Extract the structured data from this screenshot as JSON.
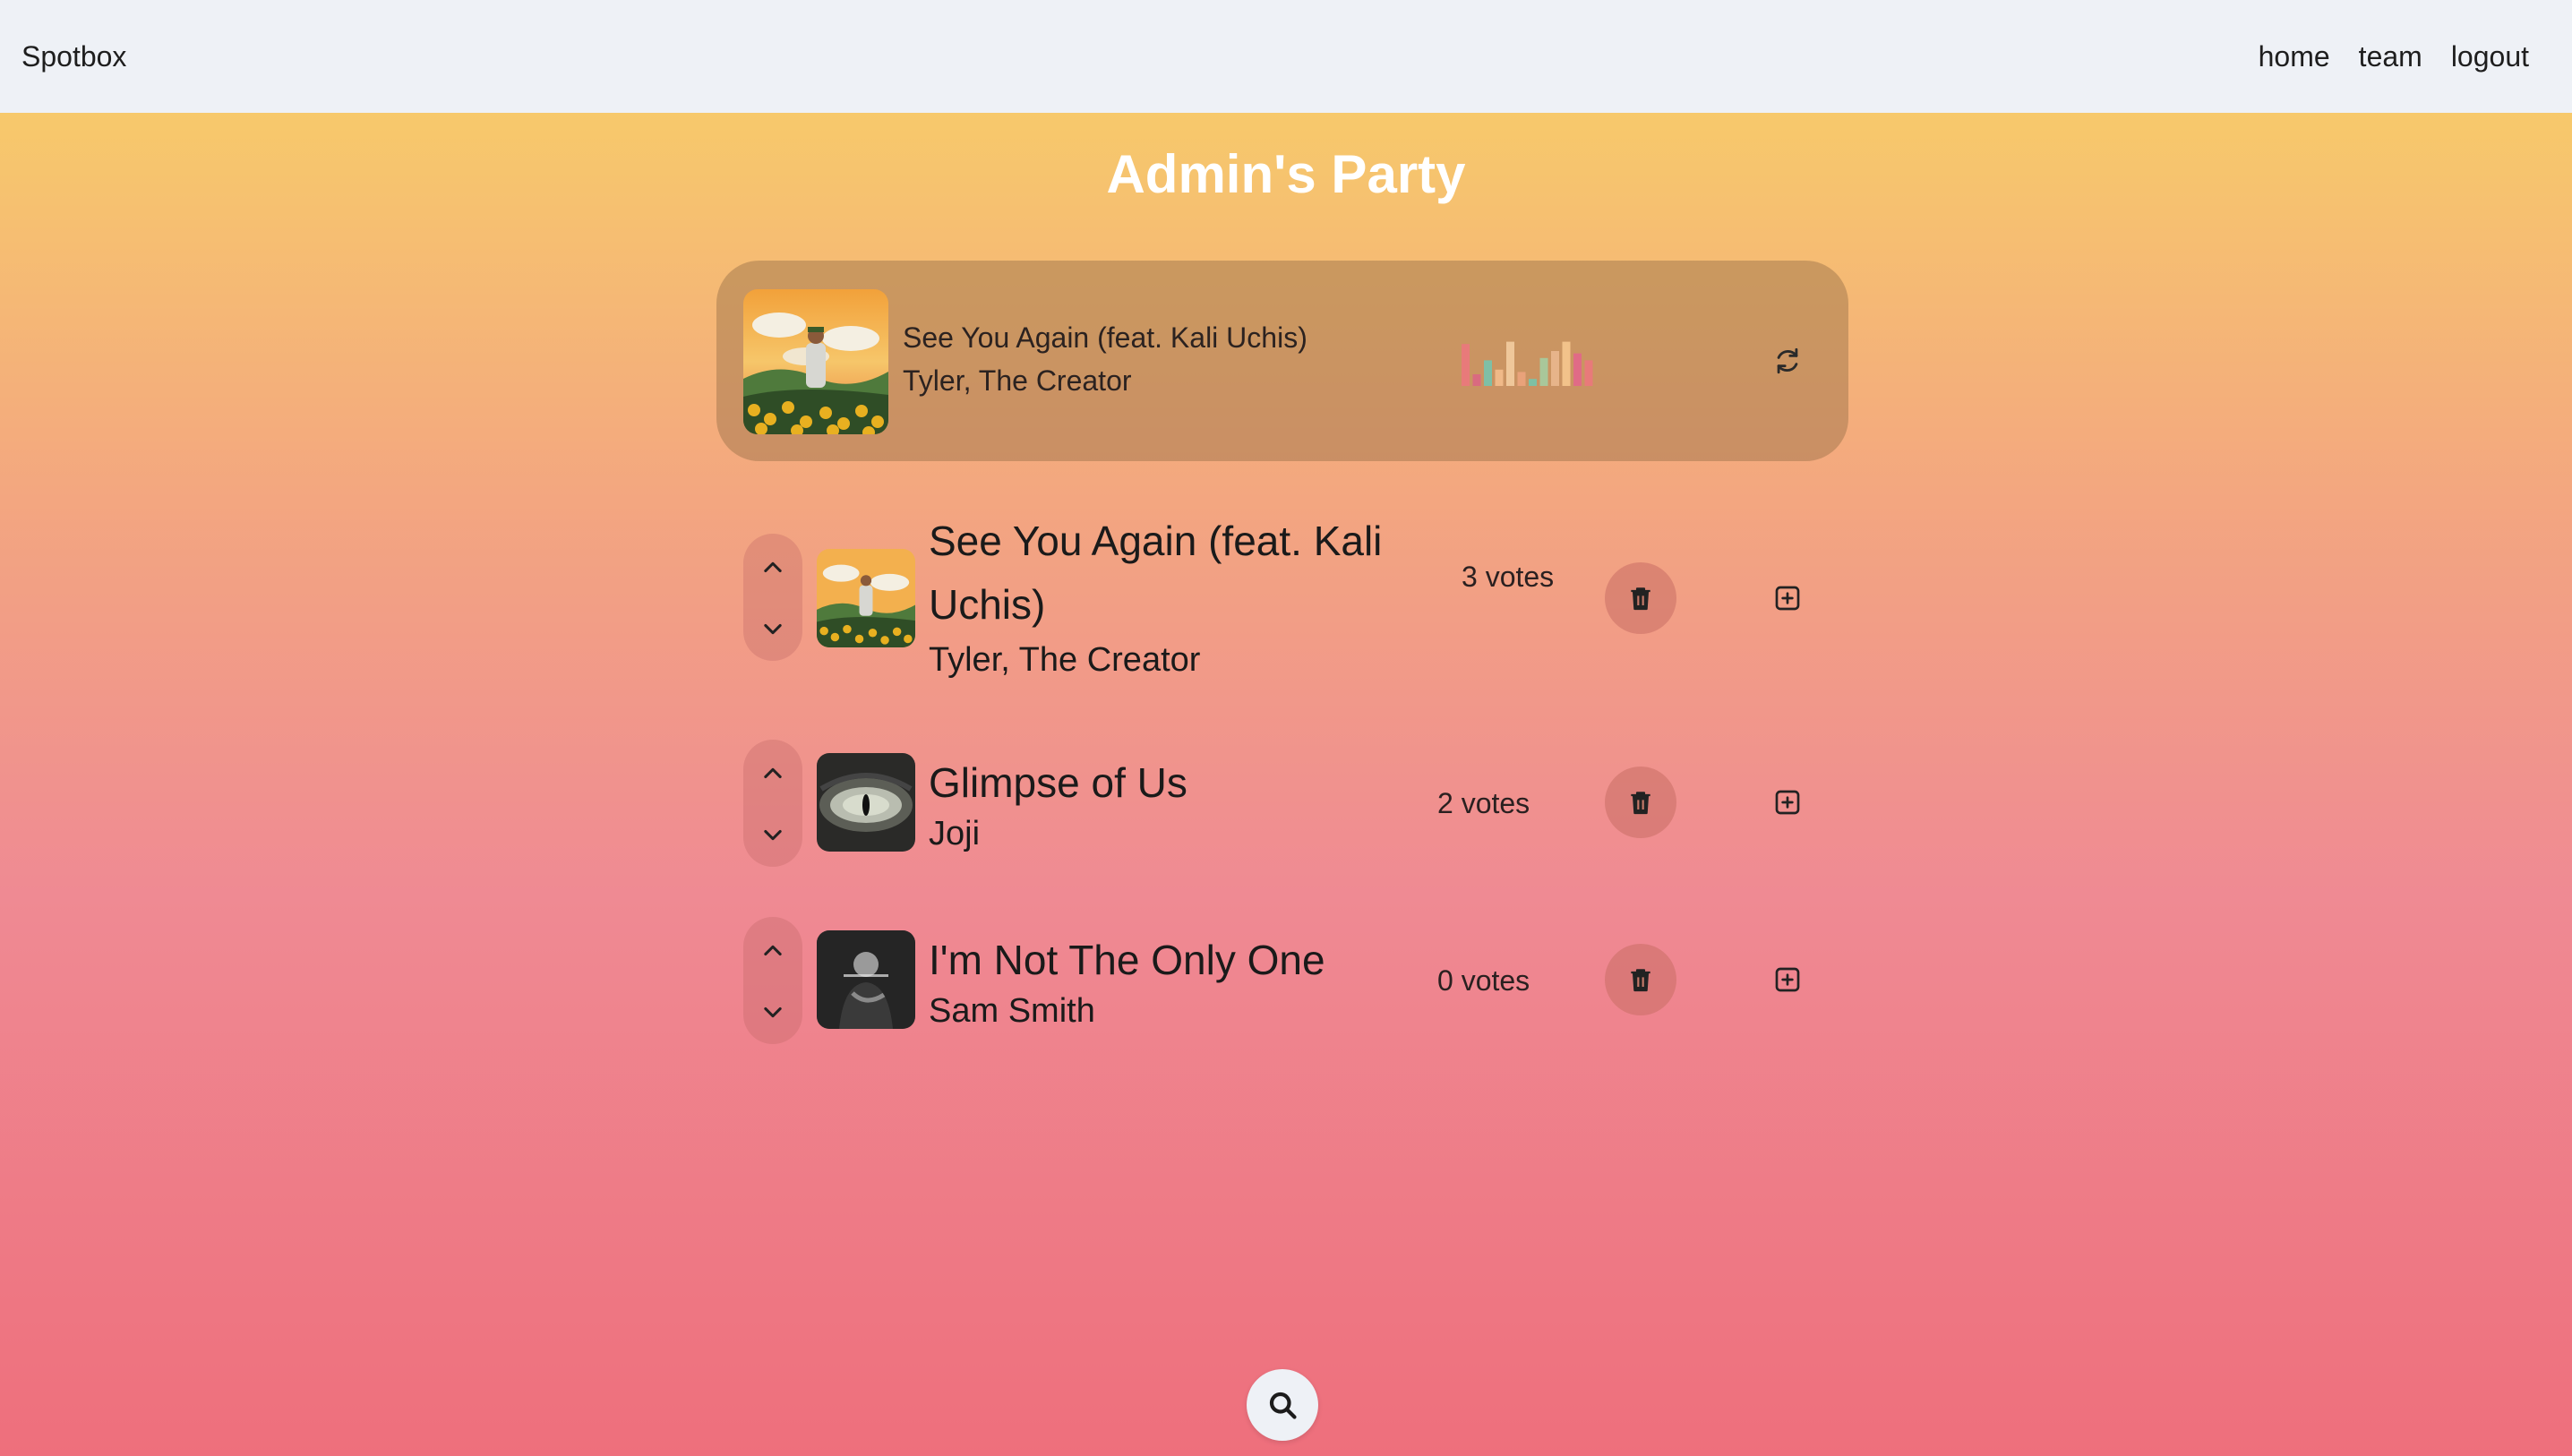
{
  "navbar": {
    "brand": "Spotbox",
    "links": [
      "home",
      "team",
      "logout"
    ]
  },
  "party": {
    "title": "Admin's Party"
  },
  "now_playing": {
    "title": "See You Again (feat. Kali Uchis)",
    "artist": "Tyler, The Creator",
    "cover_icon": "album-art-flower-boy",
    "visualizer_colors": [
      "#e87a7a",
      "#d96a80",
      "#7fbfa6",
      "#f0b988",
      "#efc79a",
      "#e9a27a",
      "#7fc0a4",
      "#a9c79a",
      "#e7b48a",
      "#f2c28a",
      "#e06b86"
    ],
    "visualizer_levels": [
      0.9,
      0.25,
      0.55,
      0.35,
      0.95,
      0.3,
      0.15,
      0.6,
      0.75,
      0.95,
      0.7,
      0.55
    ]
  },
  "queue": [
    {
      "title": "See You Again (feat. Kali Uchis)",
      "artist": "Tyler, The Creator",
      "votes": "3 votes",
      "cover_icon": "album-art-flower-boy"
    },
    {
      "title": "Glimpse of Us",
      "artist": "Joji",
      "votes": "2 votes",
      "cover_icon": "album-art-eye"
    },
    {
      "title": "I'm Not The Only One",
      "artist": "Sam Smith",
      "votes": "0 votes",
      "cover_icon": "album-art-sam-smith"
    }
  ],
  "colors": {
    "navbar_bg": "#eef1f6",
    "gradient_top": "#f7c96b",
    "gradient_bottom": "#ee6f7c"
  }
}
